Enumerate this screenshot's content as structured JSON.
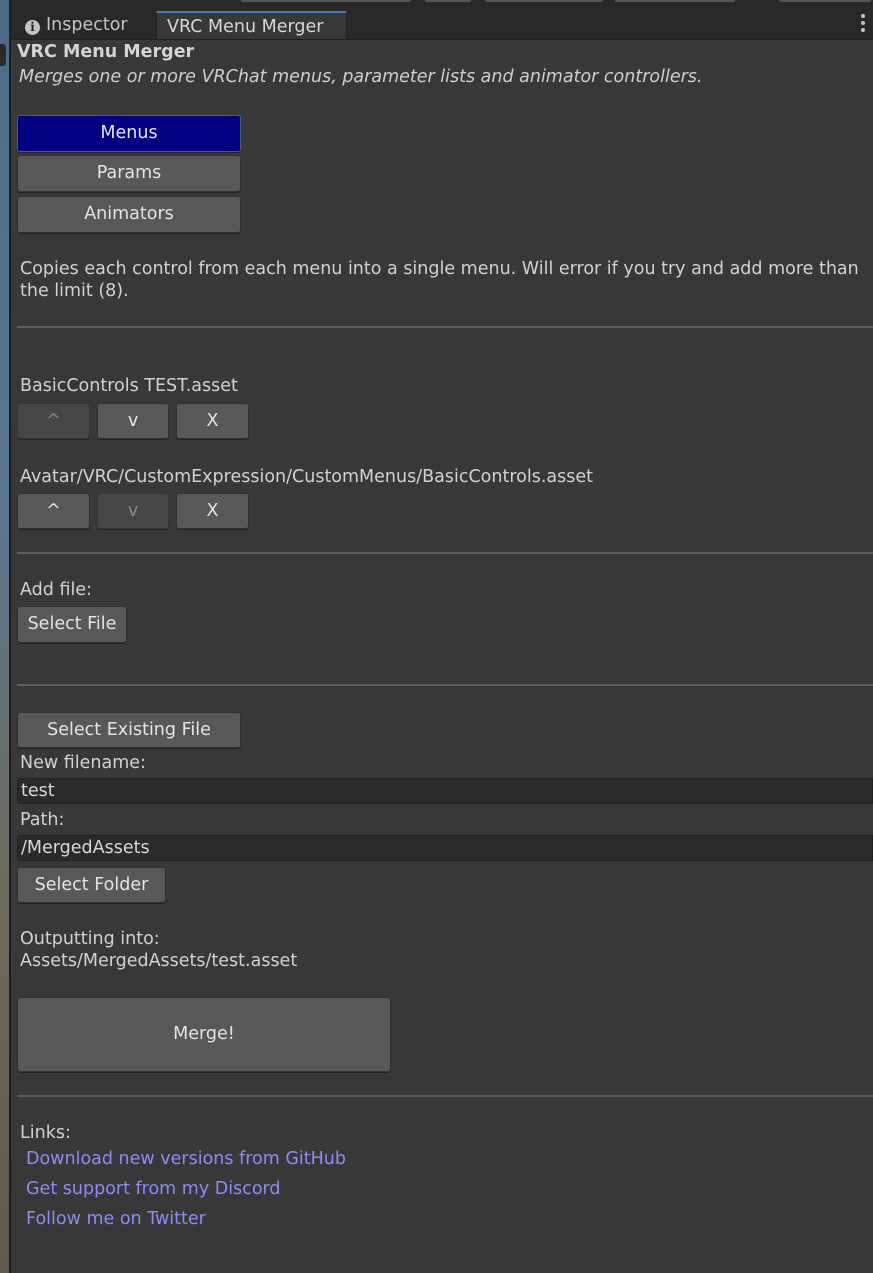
{
  "tabs": {
    "inspector": "Inspector",
    "merger": "VRC Menu Merger"
  },
  "header": {
    "title": "VRC Menu Merger",
    "subtitle": "Merges one or more VRChat menus, parameter lists and animator controllers."
  },
  "modes": {
    "menus": "Menus",
    "params": "Params",
    "animators": "Animators",
    "active": "Menus"
  },
  "description_line1": "Copies each control from each menu into a single menu. Will error if you try and add more than",
  "description_line2": "the limit (8).",
  "files": [
    {
      "name": "BasicControls TEST.asset",
      "up": "^",
      "down": "v",
      "remove": "X"
    },
    {
      "name": "Avatar/VRC/CustomExpression/CustomMenus/BasicControls.asset",
      "up": "^",
      "down": "v",
      "remove": "X"
    }
  ],
  "add_file": {
    "label": "Add file:",
    "button": "Select File"
  },
  "output": {
    "select_existing": "Select Existing File",
    "filename_label": "New filename:",
    "filename_value": "test",
    "path_label": "Path:",
    "path_value": "/MergedAssets",
    "select_folder": "Select Folder",
    "outputting_label": "Outputting into:",
    "outputting_value": "Assets/MergedAssets/test.asset",
    "merge": "Merge!"
  },
  "links": {
    "label": "Links:",
    "github": "Download new versions from GitHub",
    "discord": "Get support from my Discord",
    "twitter": "Follow me on Twitter"
  },
  "colors": {
    "background": "#383838",
    "active_tab_button": "#000080",
    "link": "#8c8cf5",
    "tab_accent": "#3a79bb"
  }
}
